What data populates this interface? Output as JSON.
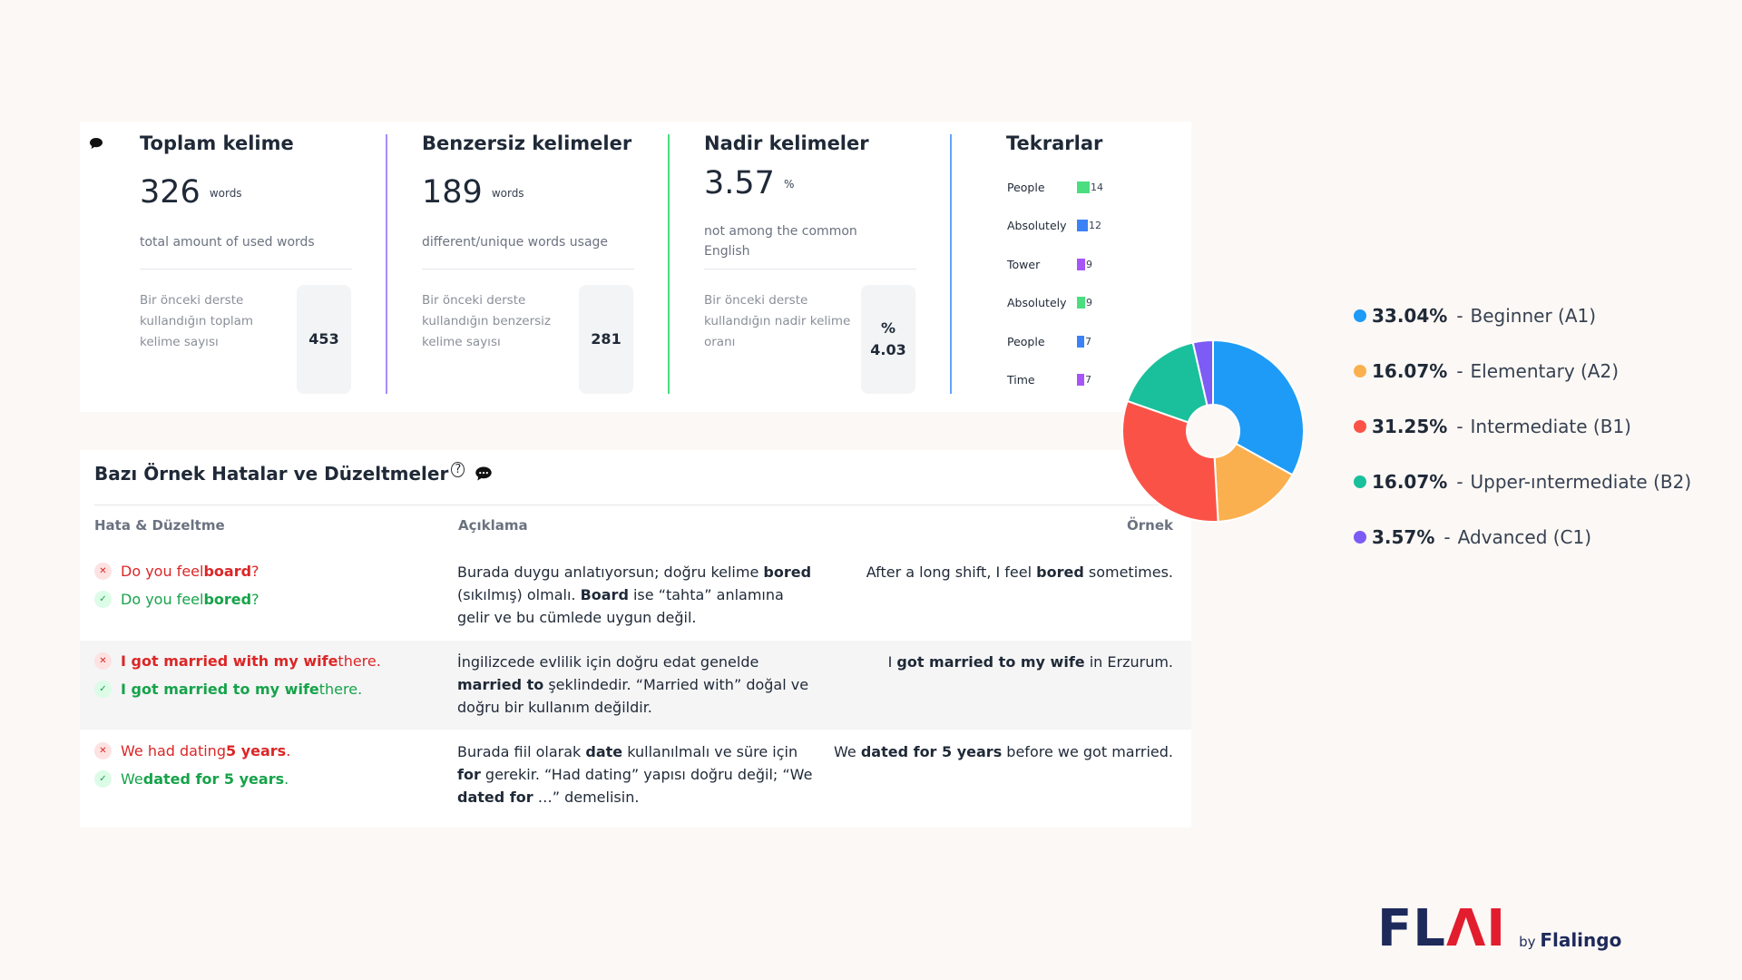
{
  "stats": {
    "total": {
      "title": "Toplam kelime",
      "value": "326",
      "unit": "words",
      "desc": "total amount of used words",
      "prev_label": "Bir önceki derste kullandığın toplam kelime sayısı",
      "prev_value": "453"
    },
    "unique": {
      "title": "Benzersiz kelimeler",
      "value": "189",
      "unit": "words",
      "desc": "different/unique words usage",
      "prev_label": "Bir önceki derste kullandığın benzersiz kelime sayısı",
      "prev_value": "281"
    },
    "rare": {
      "title": "Nadir kelimeler",
      "value": "3.57",
      "unit": "%",
      "desc": "not among the common English",
      "prev_label": "Bir önceki derste kullandığın nadir kelime oranı",
      "prev_unit": "%",
      "prev_value": "4.03"
    },
    "repetitions": {
      "title": "Tekrarlar",
      "items": [
        {
          "word": "People",
          "count": 14,
          "color": "#4ade80"
        },
        {
          "word": "Absolutely",
          "count": 12,
          "color": "#3b82f6"
        },
        {
          "word": "Tower",
          "count": 9,
          "color": "#a855f7"
        },
        {
          "word": "Absolutely",
          "count": 9,
          "color": "#4ade80"
        },
        {
          "word": "People",
          "count": 7,
          "color": "#3b82f6"
        },
        {
          "word": "Time",
          "count": 7,
          "color": "#a855f7"
        }
      ]
    }
  },
  "errors": {
    "title": "Bazı Örnek Hatalar ve Düzeltmeler",
    "help_symbol": "?",
    "headers": {
      "error": "Hata & Düzeltme",
      "explanation": "Açıklama",
      "example": "Örnek"
    },
    "rows": [
      {
        "wrong": [
          {
            "t": "Do you feel ",
            "b": false
          },
          {
            "t": "board",
            "b": true
          },
          {
            "t": "?",
            "b": false
          }
        ],
        "right": [
          {
            "t": "Do you feel ",
            "b": false
          },
          {
            "t": "bored",
            "b": true
          },
          {
            "t": "?",
            "b": false
          }
        ],
        "explanation": [
          {
            "t": "Burada duygu anlatıyorsun; doğru kelime ",
            "b": false
          },
          {
            "t": "bored",
            "b": true
          },
          {
            "t": " (sıkılmış) olmalı. ",
            "b": false
          },
          {
            "t": "Board",
            "b": true
          },
          {
            "t": " ise “tahta” anlamına gelir ve bu cümlede uygun değil.",
            "b": false
          }
        ],
        "example": [
          {
            "t": "After a long shift, I feel ",
            "b": false
          },
          {
            "t": "bored",
            "b": true
          },
          {
            "t": " sometimes.",
            "b": false
          }
        ]
      },
      {
        "wrong": [
          {
            "t": "I got married with my wife",
            "b": true
          },
          {
            "t": " there.",
            "b": false
          }
        ],
        "right": [
          {
            "t": "I got married to my wife",
            "b": true
          },
          {
            "t": " there.",
            "b": false
          }
        ],
        "explanation": [
          {
            "t": "İngilizcede evlilik için doğru edat genelde ",
            "b": false
          },
          {
            "t": "married to",
            "b": true
          },
          {
            "t": " şeklindedir. “Married with” doğal ve doğru bir kullanım değildir.",
            "b": false
          }
        ],
        "example": [
          {
            "t": "I ",
            "b": false
          },
          {
            "t": "got married to my wife",
            "b": true
          },
          {
            "t": " in Erzurum.",
            "b": false
          }
        ]
      },
      {
        "wrong": [
          {
            "t": "We had dating ",
            "b": false
          },
          {
            "t": "5 years",
            "b": true
          },
          {
            "t": ".",
            "b": false
          }
        ],
        "right": [
          {
            "t": "We ",
            "b": false
          },
          {
            "t": "dated for 5 years",
            "b": true
          },
          {
            "t": ".",
            "b": false
          }
        ],
        "explanation": [
          {
            "t": "Burada fiil olarak ",
            "b": false
          },
          {
            "t": "date",
            "b": true
          },
          {
            "t": " kullanılmalı ve süre için ",
            "b": false
          },
          {
            "t": "for",
            "b": true
          },
          {
            "t": " gerekir. “Had dating” yapısı doğru değil; “We ",
            "b": false
          },
          {
            "t": "dated for",
            "b": true
          },
          {
            "t": " …” demelisin.",
            "b": false
          }
        ],
        "example": [
          {
            "t": "We ",
            "b": false
          },
          {
            "t": "dated for 5 years",
            "b": true
          },
          {
            "t": " before we got married.",
            "b": false
          }
        ]
      }
    ]
  },
  "chart_data": {
    "type": "pie",
    "donut": true,
    "series": [
      {
        "name": "Beginner (A1)",
        "value": 33.04,
        "label": "33.04%",
        "color": "#1e9bf7"
      },
      {
        "name": "Elementary (A2)",
        "value": 16.07,
        "label": "16.07%",
        "color": "#fbb04f"
      },
      {
        "name": "Intermediate (B1)",
        "value": 31.25,
        "label": "31.25%",
        "color": "#fb5247"
      },
      {
        "name": "Upper-ıntermediate (B2)",
        "value": 16.07,
        "label": "16.07%",
        "color": "#19c09b"
      },
      {
        "name": "Advanced (C1)",
        "value": 3.57,
        "label": "3.57%",
        "color": "#7c5cf5"
      }
    ],
    "legend_separator": "-",
    "legend": "right"
  },
  "logo": {
    "main_a": "FL",
    "main_b": "Λ",
    "main_c": "I",
    "by": "by",
    "brand": "Flalingo"
  }
}
